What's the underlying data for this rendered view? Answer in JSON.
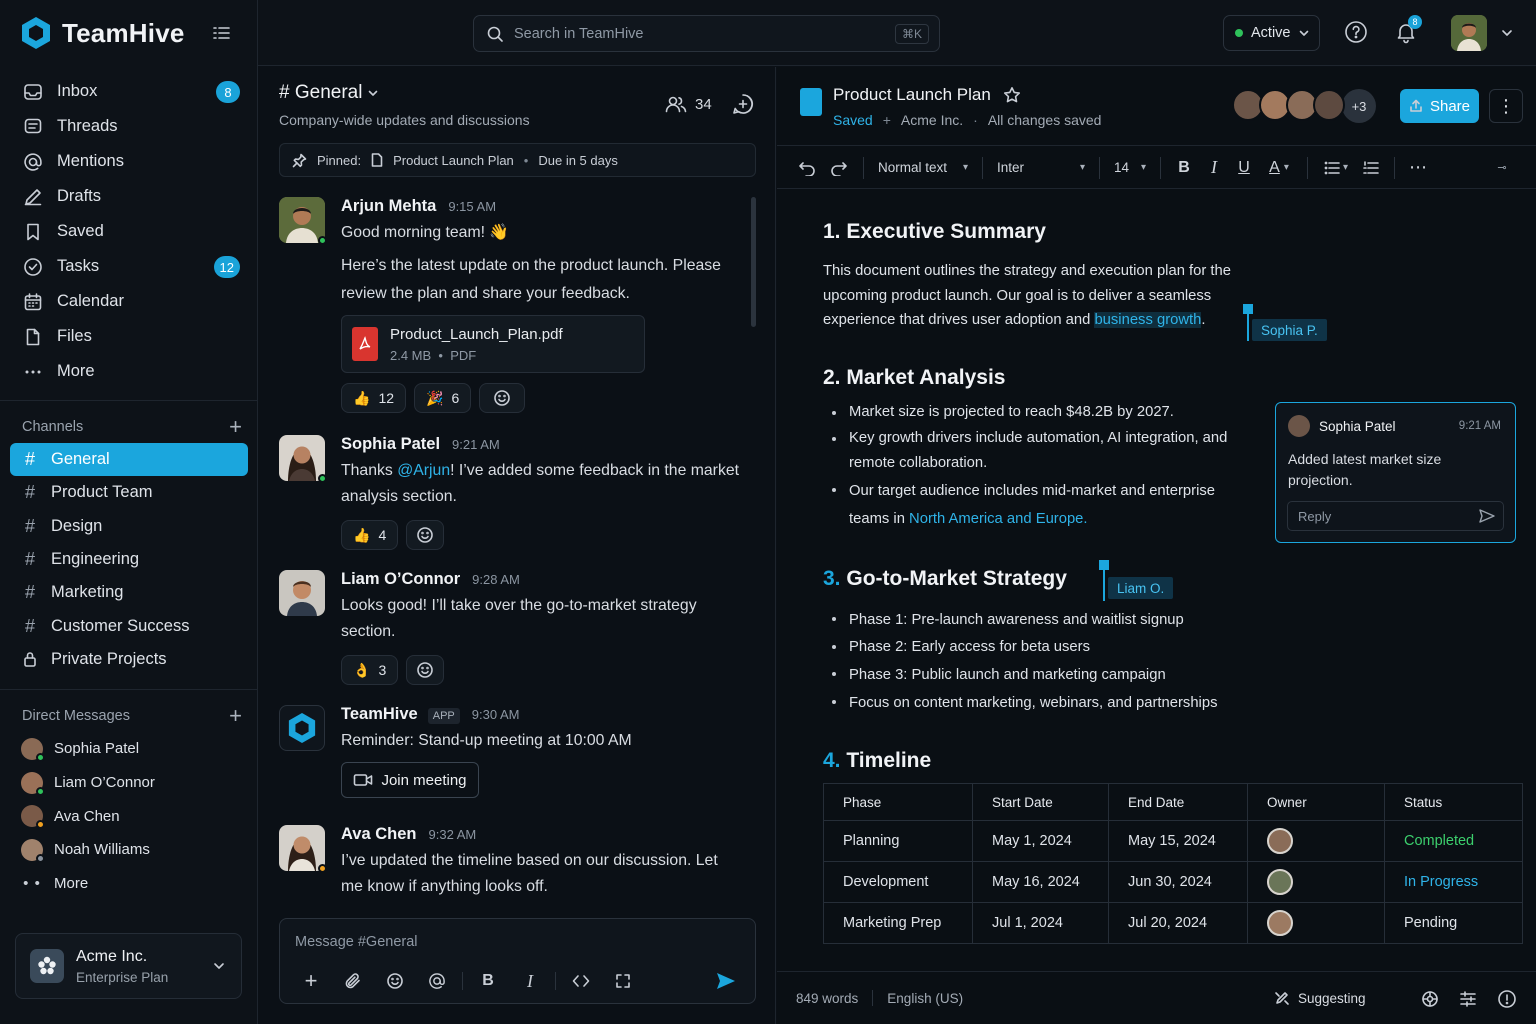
{
  "app": {
    "name": "TeamHive",
    "accent": "#1ba6dd"
  },
  "sidebar": {
    "nav": [
      {
        "label": "Inbox",
        "icon": "inbox-icon",
        "badge": "8"
      },
      {
        "label": "Threads",
        "icon": "threads-icon"
      },
      {
        "label": "Mentions",
        "icon": "at-icon"
      },
      {
        "label": "Drafts",
        "icon": "pencil-icon"
      },
      {
        "label": "Saved",
        "icon": "bookmark-icon"
      },
      {
        "label": "Tasks",
        "icon": "check-circle-icon",
        "badge": "12"
      },
      {
        "label": "Calendar",
        "icon": "calendar-icon"
      },
      {
        "label": "Files",
        "icon": "file-icon"
      },
      {
        "label": "More",
        "icon": "more-icon"
      }
    ],
    "channels_heading": "Channels",
    "channels": [
      {
        "label": "General",
        "active": true
      },
      {
        "label": "Product Team"
      },
      {
        "label": "Design"
      },
      {
        "label": "Engineering"
      },
      {
        "label": "Marketing"
      },
      {
        "label": "Customer Success"
      },
      {
        "label": "Private Projects",
        "private": true
      }
    ],
    "dm_heading": "Direct Messages",
    "dms": [
      {
        "label": "Sophia Patel",
        "status": "#2fc25b"
      },
      {
        "label": "Liam O’Connor",
        "status": "#2fc25b"
      },
      {
        "label": "Ava Chen",
        "status": "#f0a020"
      },
      {
        "label": "Noah Williams",
        "status": "#8a939e"
      },
      {
        "label": "More"
      }
    ],
    "workspace": {
      "name": "Acme Inc.",
      "plan": "Enterprise Plan"
    }
  },
  "topbar": {
    "search_placeholder": "Search in TeamHive",
    "shortcut": "⌘K",
    "status": "Active",
    "notif_count": "8"
  },
  "chat": {
    "channel": "# General",
    "description": "Company-wide updates and discussions",
    "member_count": "34",
    "pinned": {
      "label": "Pinned:",
      "doc": "Product Launch Plan",
      "due": "Due in 5 days"
    },
    "messages": [
      {
        "author": "Arjun Mehta",
        "time": "9:15 AM",
        "text1": "Good morning team! 👋",
        "text2": "Here’s the latest update on the product launch. Please review the plan and share your feedback.",
        "attachment": {
          "name": "Product_Launch_Plan.pdf",
          "size": "2.4 MB",
          "type": "PDF"
        },
        "reactions": [
          {
            "emoji": "👍",
            "count": "12"
          },
          {
            "emoji": "🎉",
            "count": "6"
          }
        ]
      },
      {
        "author": "Sophia Patel",
        "time": "9:21 AM",
        "pre": "Thanks ",
        "mention": "@Arjun",
        "post": "! I’ve added some feedback in the market analysis section.",
        "reactions": [
          {
            "emoji": "👍",
            "count": "4"
          }
        ]
      },
      {
        "author": "Liam O’Connor",
        "time": "9:28 AM",
        "text": "Looks good! I’ll take over the go-to-market strategy section.",
        "reactions": [
          {
            "emoji": "👌",
            "count": "3"
          }
        ]
      },
      {
        "author": "TeamHive",
        "tag": "APP",
        "time": "9:30 AM",
        "text": "Reminder: Stand-up meeting at 10:00 AM",
        "button": "Join meeting"
      },
      {
        "author": "Ava Chen",
        "time": "9:32 AM",
        "text": "I’ve updated the timeline based on our discussion. Let me know if anything looks off."
      }
    ],
    "composer_placeholder": "Message #General"
  },
  "doc": {
    "title": "Product Launch Plan",
    "saved": "Saved",
    "org": "Acme Inc.",
    "save_state": "All changes saved",
    "more_collaborators": "+3",
    "share": "Share",
    "toolbar": {
      "style": "Normal text",
      "font": "Inter",
      "size": "14"
    },
    "s1": {
      "num": "1.",
      "title": "Executive Summary",
      "body": "This document outlines the strategy and execution plan for the upcoming product launch. Our goal is to deliver a seamless experience that drives user adoption and ",
      "highlight": "business growth",
      "end": "."
    },
    "cursor1": "Sophia P.",
    "s2": {
      "num": "2.",
      "title": "Market Analysis",
      "b1": "Market size is projected to reach $48.2B by 2027.",
      "b2": "Key growth drivers include automation, AI integration, and remote collaboration.",
      "b3a": "Our target audience includes mid-market and enterprise teams in ",
      "b3link": "North America and Europe."
    },
    "comment": {
      "author": "Sophia Patel",
      "time": "9:21 AM",
      "text": "Added latest market size projection.",
      "reply": "Reply"
    },
    "s3": {
      "num": "3.",
      "title": "Go-to-Market Strategy",
      "bullets": [
        "Phase 1:  Pre-launch awareness and waitlist signup",
        "Phase 2: Early access for beta users",
        "Phase 3: Public launch and marketing campaign",
        "Focus on content marketing, webinars, and partnerships"
      ]
    },
    "cursor2": "Liam O.",
    "s4": {
      "num": "4.",
      "title": "Timeline"
    },
    "table": {
      "headers": [
        "Phase",
        "Start Date",
        "End Date",
        "Owner",
        "Status"
      ],
      "rows": [
        {
          "phase": "Planning",
          "start": "May 1, 2024",
          "end": "May 15, 2024",
          "status": "Completed"
        },
        {
          "phase": "Development",
          "start": "May 16, 2024",
          "end": "Jun 30, 2024",
          "status": "In Progress"
        },
        {
          "phase": "Marketing Prep",
          "start": "Jul 1, 2024",
          "end": "Jul 20, 2024",
          "status": "Pending"
        }
      ]
    },
    "footer": {
      "words": "849 words",
      "lang": "English (US)",
      "mode": "Suggesting"
    }
  }
}
